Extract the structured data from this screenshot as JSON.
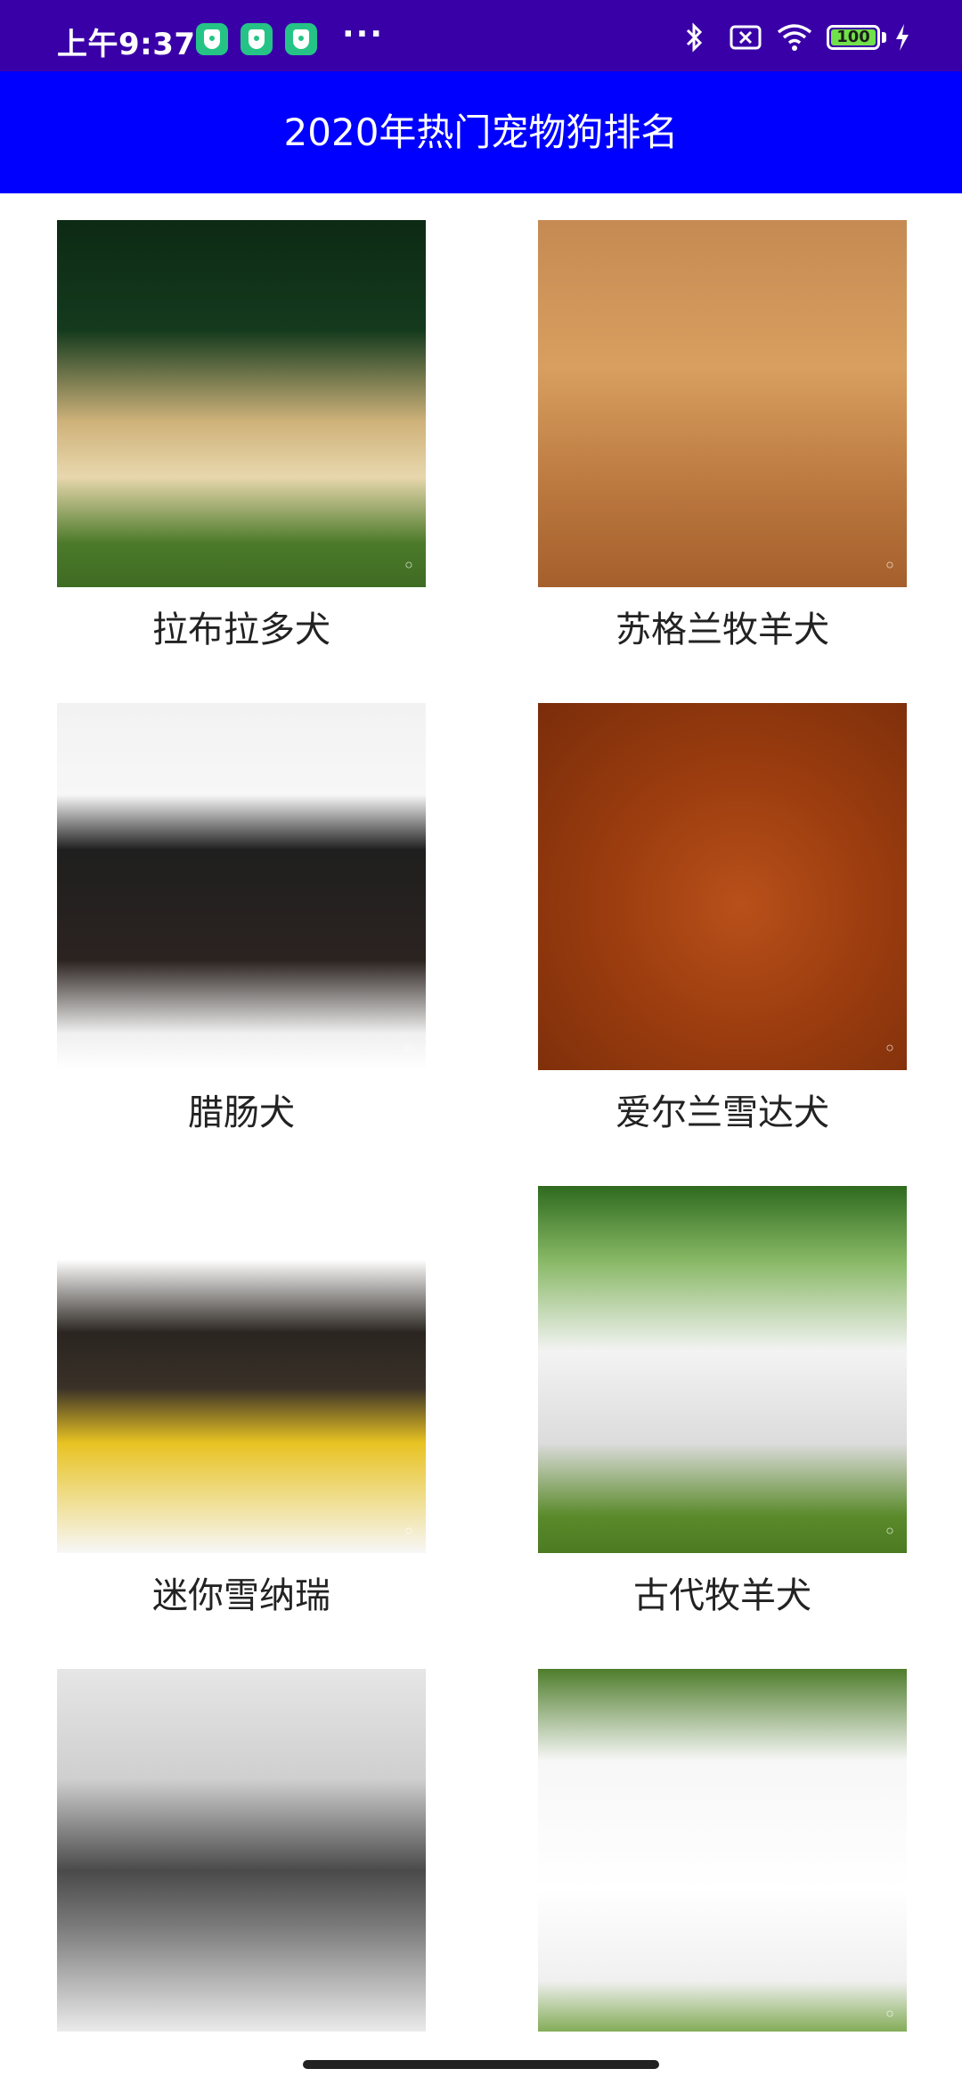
{
  "status_bar": {
    "time": "上午9:37",
    "more": "···",
    "battery": "100",
    "icons": [
      "shield-app-icon",
      "shield-app-icon",
      "shield-app-icon",
      "bluetooth-icon",
      "sim-x-icon",
      "wifi-icon",
      "battery-icon",
      "charging-bolt-icon"
    ],
    "colors": {
      "background": "#3a00a8",
      "app_icon": "#25c486",
      "battery_fill": "#71e14b"
    }
  },
  "app_bar": {
    "title": "2020年热门宠物狗排名",
    "color": "#0000ff"
  },
  "dogs": [
    {
      "name": "拉布拉多犬"
    },
    {
      "name": "苏格兰牧羊犬"
    },
    {
      "name": "腊肠犬"
    },
    {
      "name": "爱尔兰雪达犬"
    },
    {
      "name": "迷你雪纳瑞"
    },
    {
      "name": "古代牧羊犬"
    },
    {
      "name": ""
    },
    {
      "name": ""
    }
  ]
}
